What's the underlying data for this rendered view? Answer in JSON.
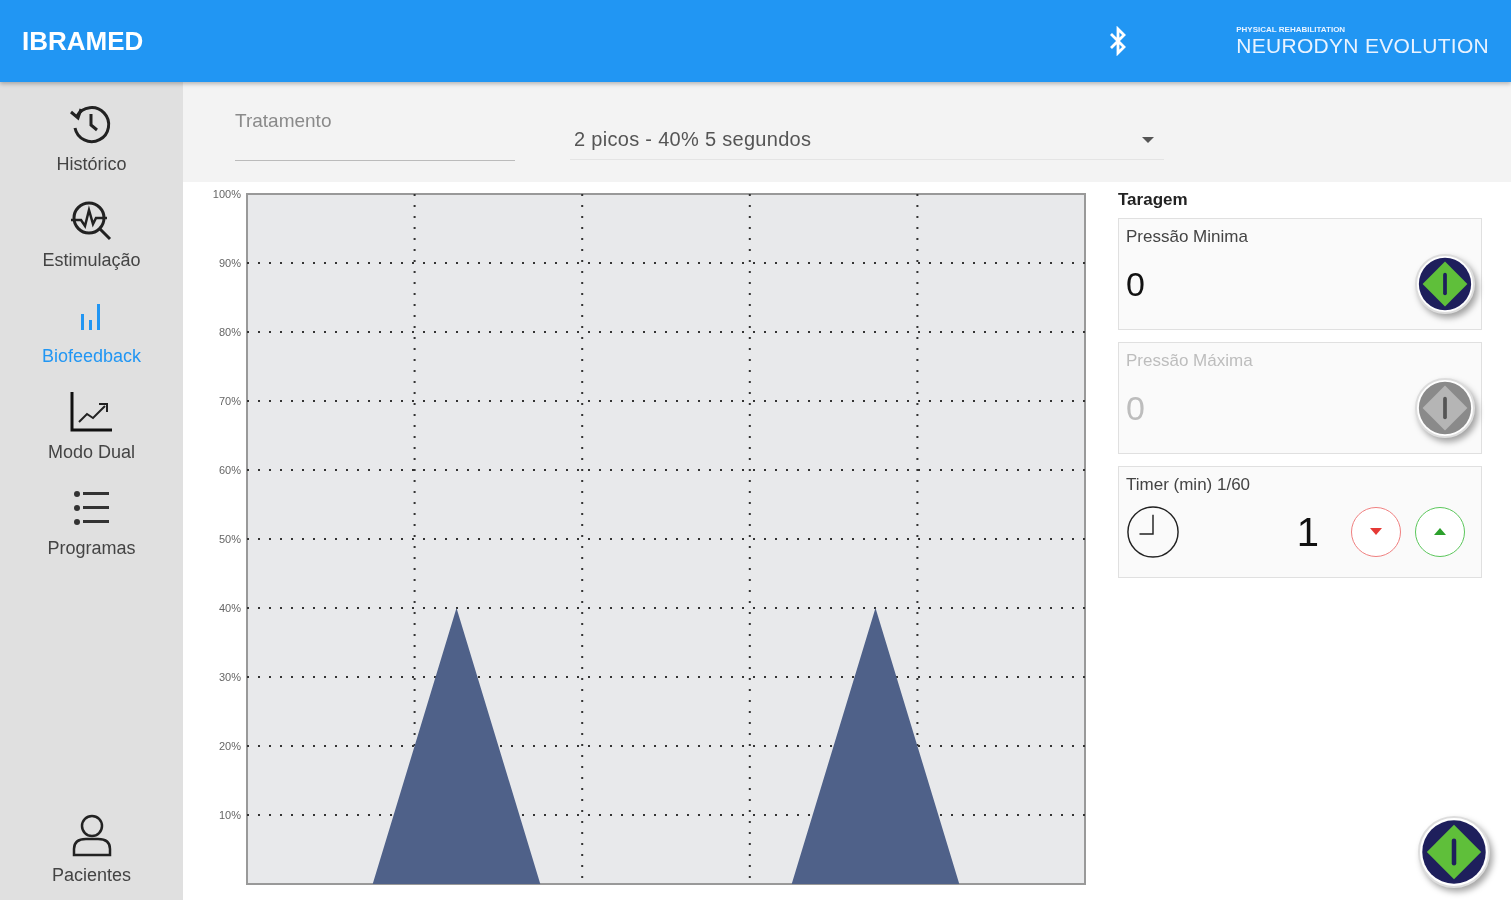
{
  "header": {
    "title": "IBRAMED",
    "logo_tagline": "PHYSICAL REHABILITATION",
    "logo_name": "NEURODYN EVOLUTION"
  },
  "sidebar": {
    "items": [
      {
        "kind": "history",
        "label": "Histórico",
        "selected": false
      },
      {
        "kind": "stimulation",
        "label": "Estimulação",
        "selected": false
      },
      {
        "kind": "biofeedback",
        "label": "Biofeedback",
        "selected": true
      },
      {
        "kind": "dual",
        "label": "Modo Dual",
        "selected": false
      },
      {
        "kind": "programs",
        "label": "Programas",
        "selected": false
      }
    ],
    "bottom_item": {
      "kind": "patients",
      "label": "Pacientes",
      "selected": false
    }
  },
  "treatment": {
    "placeholder": "Tratamento",
    "program": "2 picos - 40% 5 segundos"
  },
  "chart": {
    "chart_data": {
      "type": "area",
      "categories": [
        null,
        null,
        null,
        null,
        null,
        null,
        null,
        null,
        null,
        null,
        null,
        null,
        null,
        null,
        null,
        null,
        null,
        null,
        null,
        null,
        null
      ],
      "series": [
        {
          "color": "#4f6189",
          "values": [
            0,
            0,
            0,
            0,
            20,
            40,
            20,
            0,
            0,
            0,
            0,
            0,
            0,
            0,
            20,
            40,
            20,
            0,
            0,
            0,
            0
          ]
        }
      ],
      "ylim": [
        0,
        100
      ],
      "grid": true,
      "yticks": [
        {
          "value": 10,
          "label": "10%"
        },
        {
          "value": 20,
          "label": "20%"
        },
        {
          "value": 30,
          "label": "30%"
        },
        {
          "value": 40,
          "label": "40%"
        },
        {
          "value": 50,
          "label": "50%"
        },
        {
          "value": 60,
          "label": "60%"
        },
        {
          "value": 70,
          "label": "70%"
        },
        {
          "value": 80,
          "label": "80%"
        },
        {
          "value": 90,
          "label": "90%"
        },
        {
          "value": 100,
          "label": "100%"
        }
      ]
    }
  },
  "taragem": {
    "title": "Taragem",
    "cards": [
      {
        "kind": "pressure",
        "label": "Pressão Minima",
        "value": "0",
        "disabled": false
      },
      {
        "kind": "pressure",
        "label": "Pressão Máxima",
        "value": "0",
        "disabled": true
      },
      {
        "kind": "timer",
        "label": "Timer (min) 1/60",
        "value": "1",
        "disabled": false
      }
    ]
  },
  "start_button": {
    "disabled": false
  }
}
